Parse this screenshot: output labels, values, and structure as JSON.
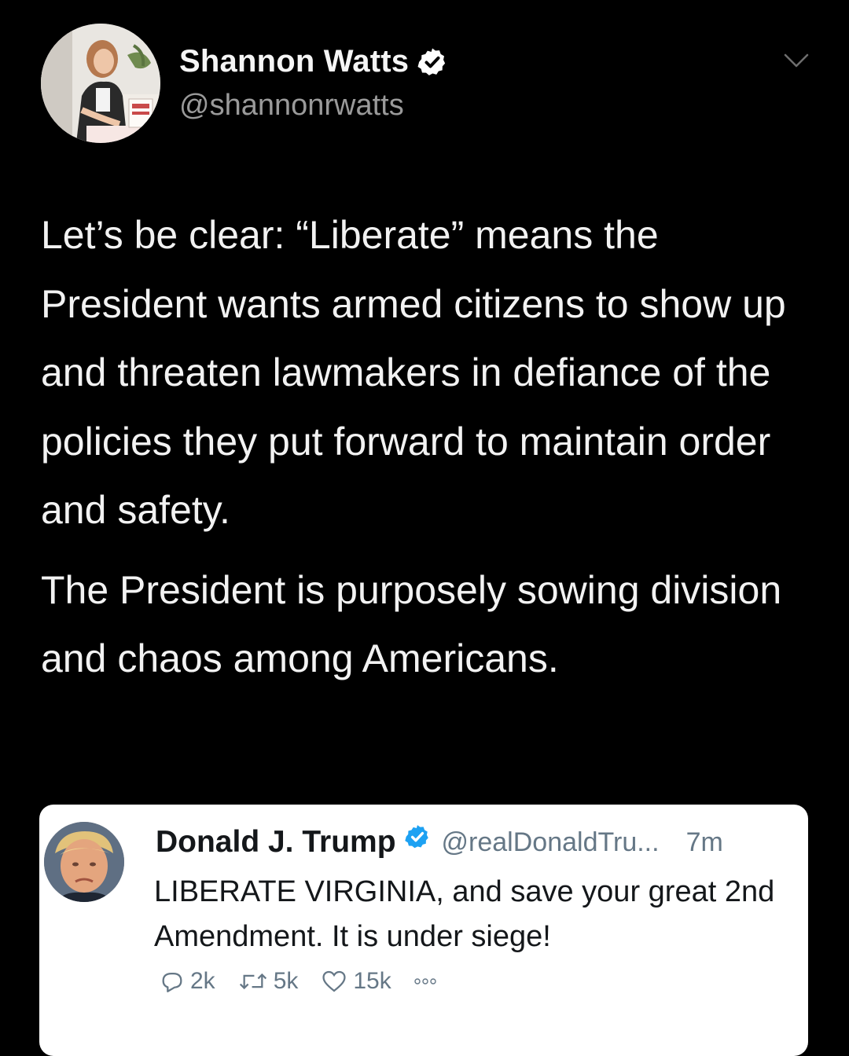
{
  "tweet": {
    "author": {
      "display_name": "Shannon Watts",
      "handle": "@shannonrwatts",
      "verified": true,
      "avatar_icon": "profile-photo"
    },
    "paragraphs": [
      "Let’s be clear: “Liberate” means the President wants armed citizens to show up and threaten lawmakers in defiance of the policies they put forward to maintain order and safety.",
      "The President is purposely sowing division and chaos among Americans."
    ],
    "menu_icon": "chevron-down-icon"
  },
  "quoted_tweet": {
    "author": {
      "display_name": "Donald J. Trump",
      "handle": "@realDonaldTru...",
      "verified": true
    },
    "time": "7m",
    "text": "LIBERATE VIRGINIA, and save your great 2nd Amendment. It is under siege!",
    "actions": {
      "replies": "2k",
      "retweets": "5k",
      "likes": "15k"
    }
  },
  "colors": {
    "background": "#000000",
    "text_primary": "#f2f2f2",
    "text_secondary": "#9a9a9a",
    "verified_badge_dark": "#ffffff",
    "verified_badge_light": "#1da1f2",
    "card_background": "#ffffff",
    "card_meta": "#657786"
  }
}
